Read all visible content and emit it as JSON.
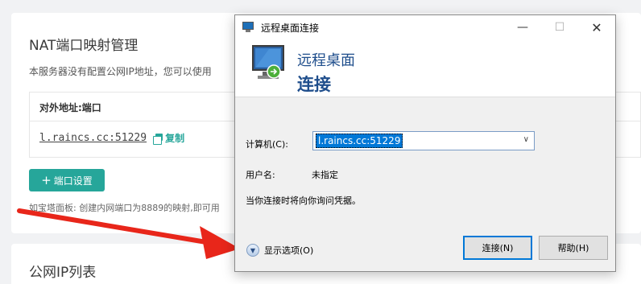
{
  "panel": {
    "title": "NAT端口映射管理",
    "description": "本服务器没有配置公网IP地址，您可以使用",
    "table_header": "对外地址:端口",
    "address": "l.raincs.cc:51229",
    "copy_label": "复制",
    "add_port_label": "端口设置",
    "hint": "如宝塔面板: 创建内网端口为8889的映射,即可用",
    "ip_list_title": "公网IP列表",
    "accent": "#26a69a"
  },
  "dialog": {
    "title": "远程桌面连接",
    "banner_line1": "远程桌面",
    "banner_line2": "连接",
    "computer_label": "计算机(C):",
    "computer_value": "l.raincs.cc:51229",
    "username_label": "用户名:",
    "username_value": "未指定",
    "credentials_note": "当你连接时将向你询问凭据。",
    "show_options": "显示选项(O)",
    "connect_button": "连接(N)",
    "help_button": "帮助(H)"
  },
  "annotation": {
    "arrow_color": "#e8261a"
  }
}
